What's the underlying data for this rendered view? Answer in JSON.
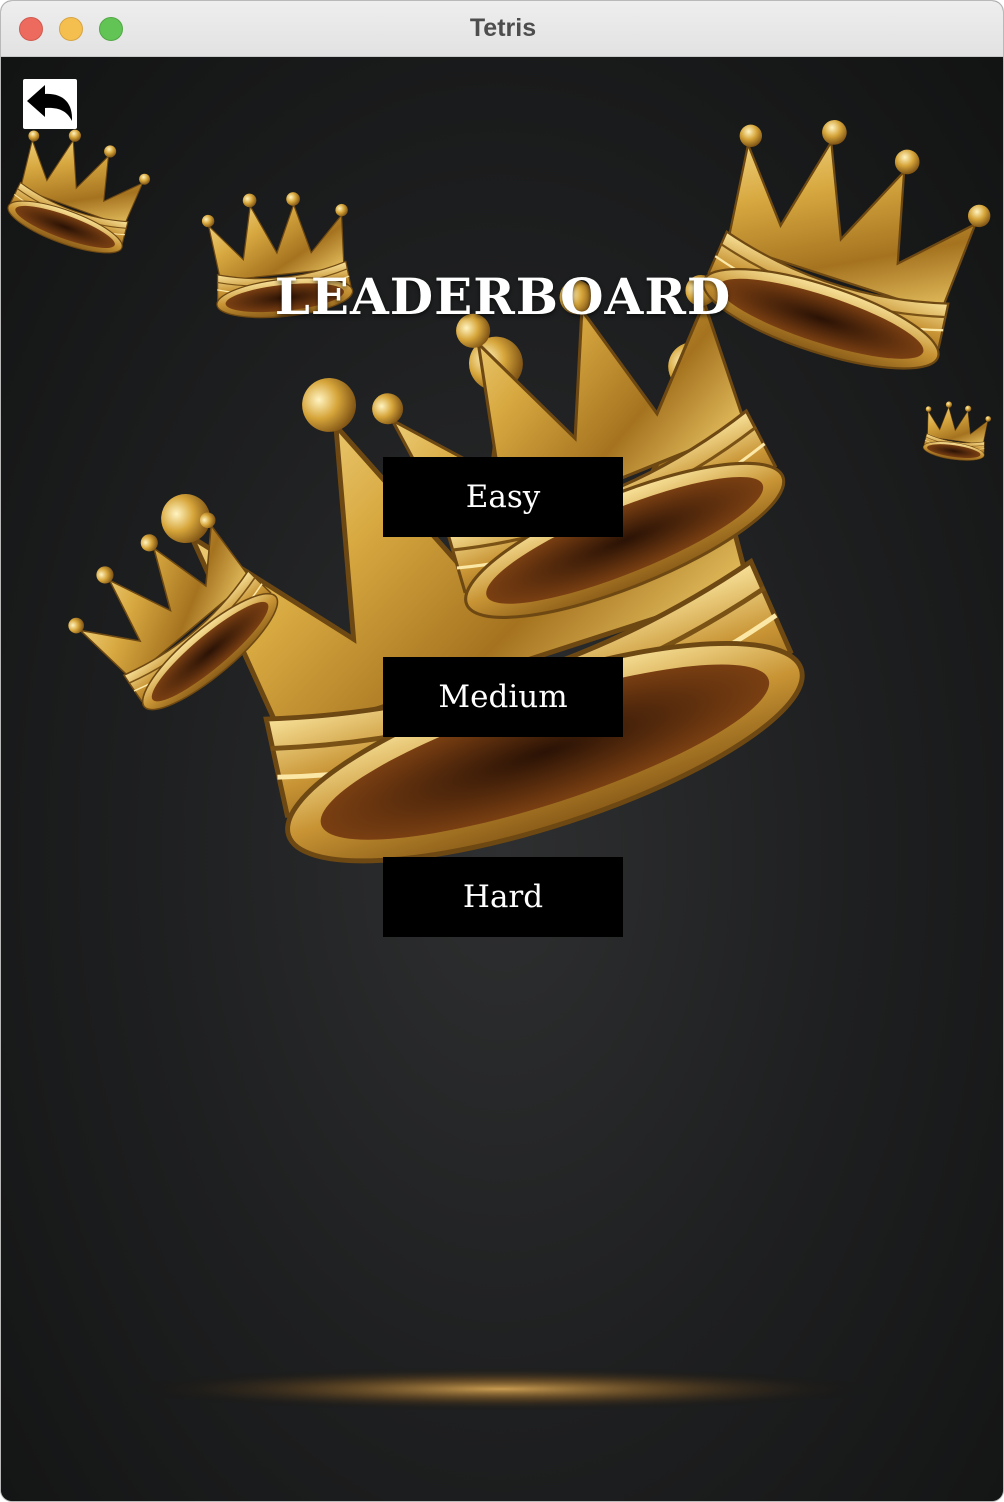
{
  "window": {
    "title": "Tetris"
  },
  "screen": {
    "heading": "LEADERBOARD"
  },
  "menu": {
    "easy_label": "Easy",
    "medium_label": "Medium",
    "hard_label": "Hard"
  },
  "icons": {
    "back": "back-arrow-icon",
    "background": "golden-crowns-artwork"
  },
  "colors": {
    "button_bg": "#000000",
    "button_text": "#ffffff",
    "heading_text": "#ffffff",
    "crown_gold": "#d4a63a",
    "crown_interior": "#5a2c0c",
    "background": "#1e1f20"
  }
}
